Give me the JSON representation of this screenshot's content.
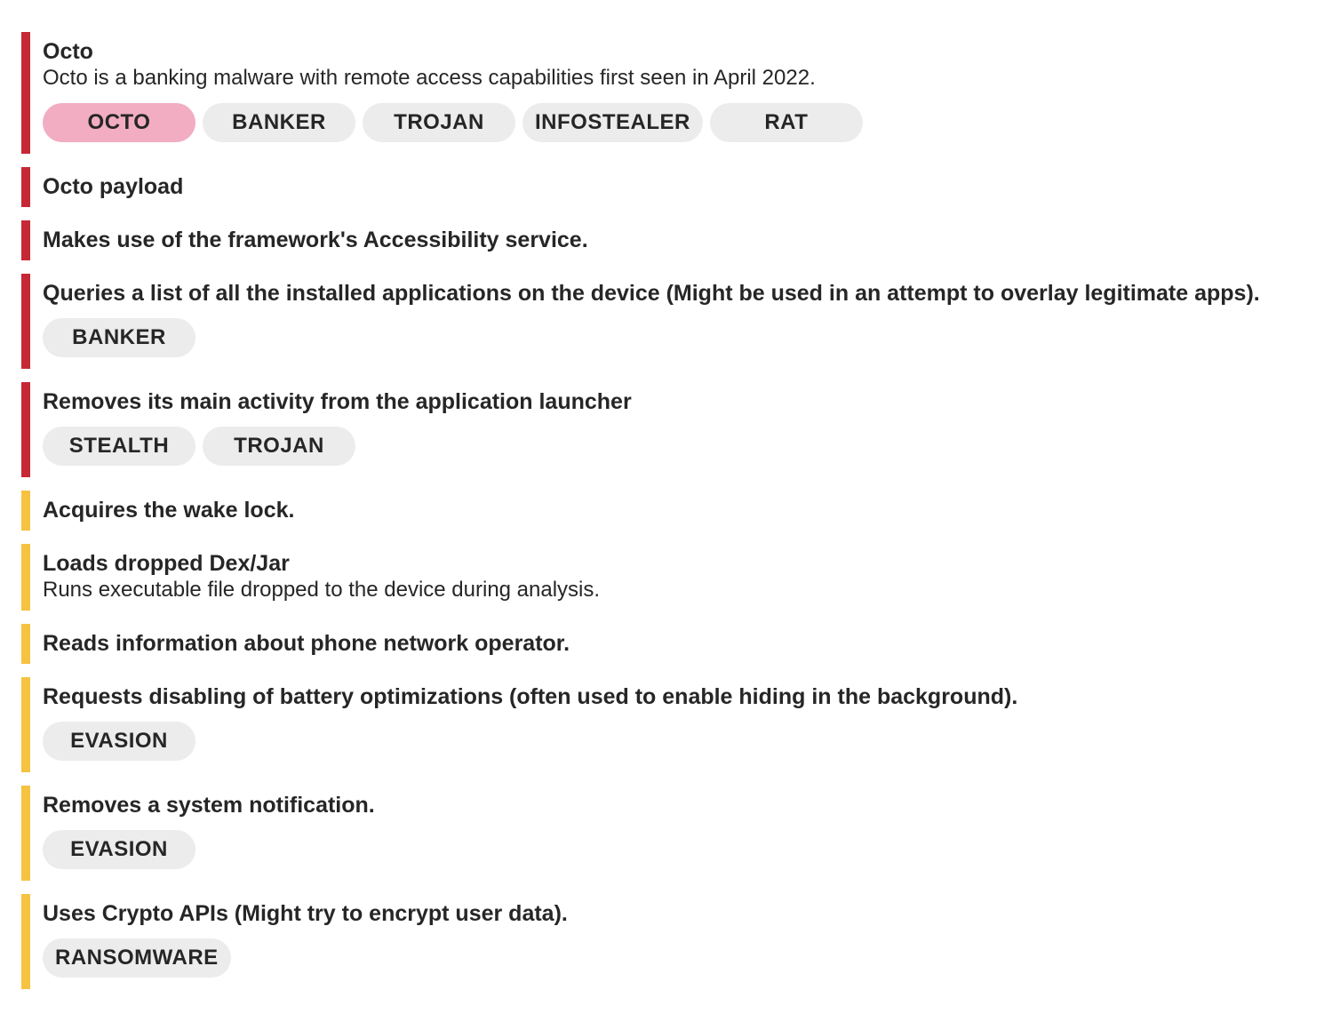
{
  "colors": {
    "high_severity_bar": "#c62836",
    "medium_severity_bar": "#f5c242",
    "tag_bg": "#ececec",
    "family_tag_bg": "#f2adc3"
  },
  "findings": [
    {
      "severity": "high",
      "title": "Octo",
      "description": "Octo is a banking malware with remote access capabilities first seen in April 2022.",
      "tags": [
        "OCTO",
        "BANKER",
        "TROJAN",
        "INFOSTEALER",
        "RAT"
      ]
    },
    {
      "severity": "high",
      "title": "Octo payload",
      "description": "",
      "tags": []
    },
    {
      "severity": "high",
      "title": "Makes use of the framework's Accessibility service.",
      "description": "",
      "tags": []
    },
    {
      "severity": "high",
      "title": "Queries a list of all the installed applications on the device (Might be used in an attempt to overlay legitimate apps).",
      "description": "",
      "tags": [
        "BANKER"
      ]
    },
    {
      "severity": "high",
      "title": "Removes its main activity from the application launcher",
      "description": "",
      "tags": [
        "STEALTH",
        "TROJAN"
      ]
    },
    {
      "severity": "medium",
      "title": "Acquires the wake lock.",
      "description": "",
      "tags": []
    },
    {
      "severity": "medium",
      "title": "Loads dropped Dex/Jar",
      "description": "Runs executable file dropped to the device during analysis.",
      "tags": []
    },
    {
      "severity": "medium",
      "title": "Reads information about phone network operator.",
      "description": "",
      "tags": []
    },
    {
      "severity": "medium",
      "title": "Requests disabling of battery optimizations (often used to enable hiding in the background).",
      "description": "",
      "tags": [
        "EVASION"
      ]
    },
    {
      "severity": "medium",
      "title": "Removes a system notification.",
      "description": "",
      "tags": [
        "EVASION"
      ]
    },
    {
      "severity": "medium",
      "title": "Uses Crypto APIs (Might try to encrypt user data).",
      "description": "",
      "tags": [
        "RANSOMWARE"
      ]
    }
  ]
}
